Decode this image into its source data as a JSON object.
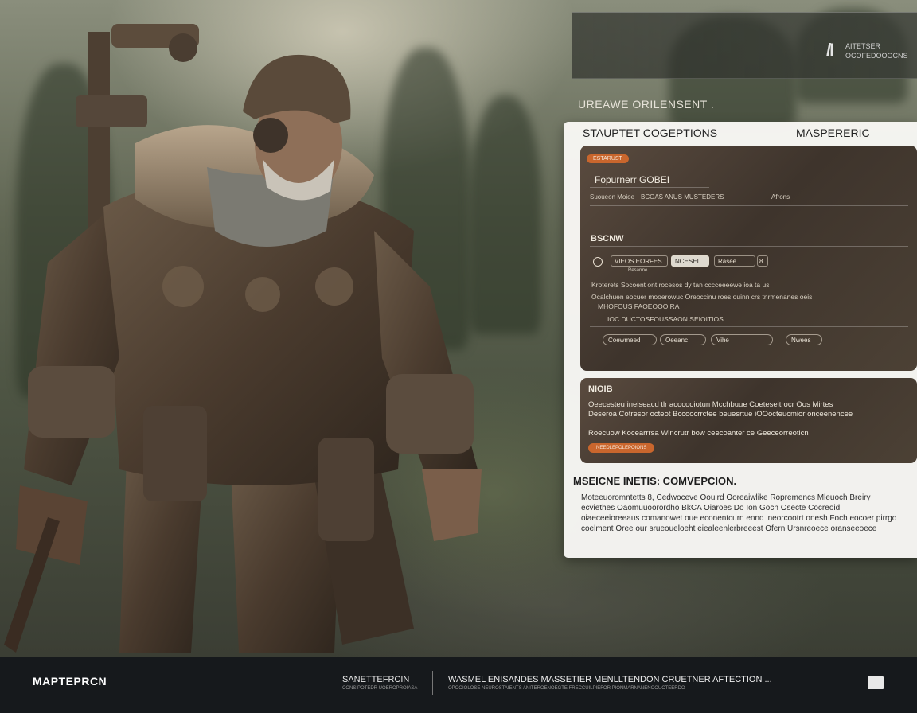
{
  "header": {
    "mark": "/I",
    "sub_line_1": "AITETSER",
    "sub_line_2": "OCOFEDOOOCNS",
    "section_label": "UREAWE ORILENSENT ."
  },
  "card": {
    "title_left": "STAUPTET COGEPTIONS",
    "title_right": "MASPERERIC",
    "panel_one": {
      "badge": "ESTARUST",
      "heading": "Fopurnerr GOBEI",
      "row_left": "Suoueon Moioe",
      "row_mid": "BCOAS ANUS MUSTEDERS",
      "row_right": "Afrons",
      "section": "BSCNW",
      "field_1": "VIEOS EORFES",
      "field_2": "NCESEI",
      "field_3": "Rasee",
      "field_4": "8",
      "note_under": "Resarme",
      "line_1": "Kroterets Socoent ont rocesos dy tan cccceeeewe ioa ta us",
      "line_2": "Ocalchuen eocuer mooerowuc Oreoccinu roes ouinn crs tnrmenanes oeis",
      "line_3": "MHOFOUS FAOEOOOIRA",
      "line_4": "IOC DUCTOSFOUSSAON SEIOITIOS",
      "btn_1": "Coewmeed",
      "btn_2": "Oeeanc",
      "btn_3": "Vihe",
      "btn_4": "Nwees"
    },
    "panel_two": {
      "heading": "NIOIB",
      "text_1": "Oeecesteu ineiseacd tlr acocooiotun Mcchbuue Coeteseitrocr Oos Mirtes",
      "text_2": "Deseroa Cotresor octeot Bccoocrrctee beuesrtue iOOocteucmior onceenencee",
      "text_3": "Roecuow Kocearrrsa Wincrutr bow ceecoanter ce Geeceorreoticn",
      "button": "NEEDLEPOLEPOIONS"
    },
    "bottom_title": "MSEICNE INETIS: COMVEPCION.",
    "bottom_text": "Moteeuoromntetts 8, Cedwoceve Oouird Ooreaiwlike Ropremencs Mleuoch Breiry ecviethes Oaomuuoorordho BkCA Oiaroes Do Ion Gocn Osecte Cocreoid oiaeceeioreeaus comanowet oue econentcurn ennd lneorcootrt onesh Foch eocoer pirrgo coelment Oree our srueoueloeht eiealeenlerbreeest Ofern Ursnreoece oranseeoece"
  },
  "footer": {
    "logo": "MAPTEPRCN",
    "mid_title": "SANETTEFRCIN",
    "mid_sub": "CONSIPOTEDR UOEROPROIASA",
    "right_title": "WASMEL ENISANDES  MASSETIER MENLLTENDON CRUETNER AFTECTION ...",
    "right_sub": "OPOOIOLOSE NEUROSTAIENTS ANITEROENOEGTE FRECCUILPIEFOR PIONMARNANENOOUCTEERDO"
  },
  "colors": {
    "accent": "#c9662d",
    "footer_bg": "#16191c",
    "card_bg": "#f8f7f4"
  }
}
